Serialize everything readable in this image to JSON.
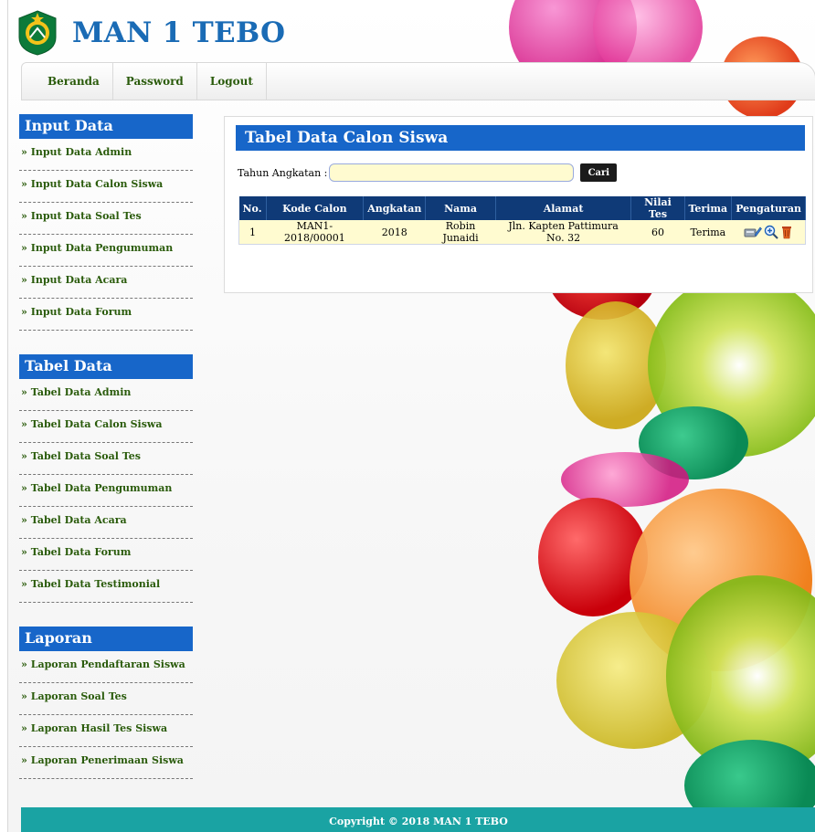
{
  "site": {
    "title": "MAN 1 TEBO"
  },
  "nav": [
    {
      "label": "Beranda"
    },
    {
      "label": "Password"
    },
    {
      "label": "Logout"
    }
  ],
  "sidebar": {
    "input": {
      "title": "Input Data",
      "items": [
        {
          "label": "» Input Data Admin"
        },
        {
          "label": "» Input Data Calon Siswa"
        },
        {
          "label": "» Input Data Soal Tes"
        },
        {
          "label": "» Input Data Pengumuman"
        },
        {
          "label": "» Input Data Acara"
        },
        {
          "label": "» Input Data Forum"
        }
      ]
    },
    "tabel": {
      "title": "Tabel Data",
      "items": [
        {
          "label": "» Tabel Data Admin"
        },
        {
          "label": "» Tabel Data Calon Siswa"
        },
        {
          "label": "» Tabel Data Soal Tes"
        },
        {
          "label": "» Tabel Data Pengumuman"
        },
        {
          "label": "» Tabel Data Acara"
        },
        {
          "label": "» Tabel Data Forum"
        },
        {
          "label": "» Tabel Data Testimonial"
        }
      ]
    },
    "laporan": {
      "title": "Laporan",
      "items": [
        {
          "label": "» Laporan Pendaftaran Siswa"
        },
        {
          "label": "» Laporan Soal Tes"
        },
        {
          "label": "» Laporan Hasil Tes Siswa"
        },
        {
          "label": "» Laporan Penerimaan Siswa"
        }
      ]
    }
  },
  "main": {
    "title": "Tabel Data Calon Siswa",
    "filter": {
      "label": "Tahun Angkatan :",
      "value": "",
      "button": "Cari"
    },
    "table": {
      "headers": [
        "No.",
        "Kode Calon",
        "Angkatan",
        "Nama",
        "Alamat",
        "Nilai Tes",
        "Terima",
        "Pengaturan"
      ],
      "rows": [
        {
          "no": "1",
          "kode": "MAN1-2018/00001",
          "angkatan": "2018",
          "nama": "Robin Junaidi",
          "alamat": "Jln. Kapten Pattimura No. 32",
          "nilai": "60",
          "terima": "Terima",
          "actions": [
            "edit-icon",
            "zoom-in-icon",
            "trash-icon"
          ]
        }
      ]
    }
  },
  "footer": {
    "text": "Copyright © 2018 MAN 1 TEBO"
  },
  "colors": {
    "accent": "#1766c9",
    "table_header": "#0f3a77",
    "row_bg": "#fffbd0",
    "footer": "#1aa3a3",
    "link": "#2a5b0b"
  }
}
